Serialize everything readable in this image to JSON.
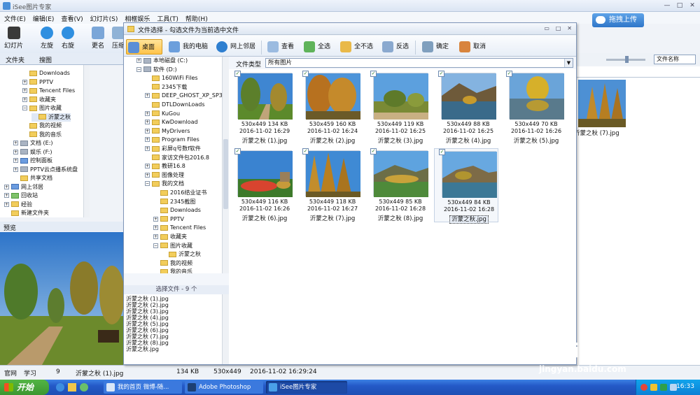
{
  "main_window": {
    "title": "iSee图片专家",
    "menu": [
      "文件(E)",
      "编辑(E)",
      "查看(V)",
      "幻灯片(S)",
      "相框娱乐",
      "工具(T)",
      "帮助(H)"
    ],
    "upload_button": "拖拽上传",
    "toolbar": [
      {
        "label": "幻灯片",
        "icon": "slideshow-icon"
      },
      {
        "label": "左旋",
        "icon": "rotate-left-icon"
      },
      {
        "label": "右旋",
        "icon": "rotate-right-icon"
      },
      {
        "label": "更名",
        "icon": "rename-icon"
      },
      {
        "label": "压缩",
        "icon": "compress-icon"
      }
    ],
    "tabs": [
      "文件夹",
      "搜图"
    ],
    "tree": [
      {
        "label": "Downloads",
        "indent": 2,
        "pm": "",
        "type": "folder"
      },
      {
        "label": "PPTV",
        "indent": 2,
        "pm": "+",
        "type": "folder"
      },
      {
        "label": "Tencent Files",
        "indent": 2,
        "pm": "+",
        "type": "folder"
      },
      {
        "label": "收藏夹",
        "indent": 2,
        "pm": "+",
        "type": "folder"
      },
      {
        "label": "图片收藏",
        "indent": 2,
        "pm": "−",
        "type": "folder"
      },
      {
        "label": "沂蒙之秋",
        "indent": 3,
        "pm": "",
        "type": "folder",
        "selected": true
      },
      {
        "label": "我的视频",
        "indent": 2,
        "pm": "",
        "type": "folder"
      },
      {
        "label": "我的音乐",
        "indent": 2,
        "pm": "",
        "type": "folder"
      },
      {
        "label": "文档 (E:)",
        "indent": 1,
        "pm": "+",
        "type": "drive"
      },
      {
        "label": "娱乐 (F:)",
        "indent": 1,
        "pm": "+",
        "type": "drive"
      },
      {
        "label": "控制面板",
        "indent": 1,
        "pm": "+",
        "type": "control"
      },
      {
        "label": "PPTV云点播系统盘",
        "indent": 1,
        "pm": "+",
        "type": "drive"
      },
      {
        "label": "共享文档",
        "indent": 1,
        "pm": "",
        "type": "folder"
      },
      {
        "label": "网上邻居",
        "indent": 0,
        "pm": "+",
        "type": "network"
      },
      {
        "label": "回收站",
        "indent": 0,
        "pm": "+",
        "type": "recycle"
      },
      {
        "label": "经验",
        "indent": 0,
        "pm": "+",
        "type": "folder"
      },
      {
        "label": "新建文件夹",
        "indent": 0,
        "pm": "",
        "type": "folder"
      }
    ],
    "preview_label": "预览",
    "sort_select": "文件名称",
    "right_thumb_name": "沂蒙之秋 (7).jpg"
  },
  "dialog": {
    "title": "文件选择 - 勾选文件为当前选中文件",
    "toolbar": [
      {
        "label": "桌面",
        "icon": "desktop-icon",
        "active": true
      },
      {
        "label": "我的电脑",
        "icon": "computer-icon"
      },
      {
        "label": "网上邻居",
        "icon": "network-icon"
      },
      {
        "label": "查看",
        "icon": "view-icon"
      },
      {
        "label": "全选",
        "icon": "select-all-icon"
      },
      {
        "label": "全不选",
        "icon": "select-none-icon"
      },
      {
        "label": "反选",
        "icon": "invert-select-icon"
      },
      {
        "label": "确定",
        "icon": "ok-icon"
      },
      {
        "label": "取消",
        "icon": "cancel-icon"
      }
    ],
    "file_type_label": "文件类型",
    "file_type_value": "所有图片",
    "tree": [
      {
        "label": "本地磁盘 (C:)",
        "indent": 1,
        "pm": "+",
        "type": "drive"
      },
      {
        "label": "软件 (D:)",
        "indent": 1,
        "pm": "−",
        "type": "drive"
      },
      {
        "label": "160WiFi Files",
        "indent": 2,
        "pm": "",
        "type": "folder"
      },
      {
        "label": "2345下载",
        "indent": 2,
        "pm": "",
        "type": "folder"
      },
      {
        "label": "DEEP_GHOST_XP_SP3_",
        "indent": 2,
        "pm": "+",
        "type": "folder"
      },
      {
        "label": "DTLDownLoads",
        "indent": 2,
        "pm": "",
        "type": "folder"
      },
      {
        "label": "KuGou",
        "indent": 2,
        "pm": "+",
        "type": "folder"
      },
      {
        "label": "KwDownload",
        "indent": 2,
        "pm": "+",
        "type": "folder"
      },
      {
        "label": "MyDrivers",
        "indent": 2,
        "pm": "+",
        "type": "folder"
      },
      {
        "label": "Program Files",
        "indent": 2,
        "pm": "+",
        "type": "folder"
      },
      {
        "label": "彩屏q号数f软件",
        "indent": 2,
        "pm": "+",
        "type": "folder"
      },
      {
        "label": "家访文件包2016.8",
        "indent": 2,
        "pm": "",
        "type": "folder"
      },
      {
        "label": "教研16.8",
        "indent": 2,
        "pm": "+",
        "type": "folder"
      },
      {
        "label": "图像处理",
        "indent": 2,
        "pm": "+",
        "type": "folder"
      },
      {
        "label": "我的文档",
        "indent": 2,
        "pm": "−",
        "type": "folder"
      },
      {
        "label": "2016结业证书",
        "indent": 3,
        "pm": "",
        "type": "folder"
      },
      {
        "label": "2345截图",
        "indent": 3,
        "pm": "",
        "type": "folder"
      },
      {
        "label": "Downloads",
        "indent": 3,
        "pm": "",
        "type": "folder"
      },
      {
        "label": "PPTV",
        "indent": 3,
        "pm": "+",
        "type": "folder"
      },
      {
        "label": "Tencent Files",
        "indent": 3,
        "pm": "+",
        "type": "folder"
      },
      {
        "label": "收藏夹",
        "indent": 3,
        "pm": "+",
        "type": "folder"
      },
      {
        "label": "图片收藏",
        "indent": 3,
        "pm": "−",
        "type": "folder"
      },
      {
        "label": "沂蒙之秋",
        "indent": 4,
        "pm": "",
        "type": "folder"
      },
      {
        "label": "我的视频",
        "indent": 3,
        "pm": "",
        "type": "folder"
      },
      {
        "label": "我的音乐",
        "indent": 3,
        "pm": "",
        "type": "folder"
      }
    ],
    "selection_header": "选择文件 - 9 个",
    "selection_list": [
      "沂蒙之秋 (1).jpg",
      "沂蒙之秋 (2).jpg",
      "沂蒙之秋 (3).jpg",
      "沂蒙之秋 (4).jpg",
      "沂蒙之秋 (5).jpg",
      "沂蒙之秋 (6).jpg",
      "沂蒙之秋 (7).jpg",
      "沂蒙之秋 (8).jpg",
      "沂蒙之秋.jpg"
    ],
    "thumbnails": [
      {
        "name": "沂蒙之秋 (1).jpg",
        "dims": "530x449",
        "size": "134 KB",
        "date": "2016-11-02 16:29",
        "checked": true
      },
      {
        "name": "沂蒙之秋 (2).jpg",
        "dims": "530x459",
        "size": "160 KB",
        "date": "2016-11-02 16:24",
        "checked": true
      },
      {
        "name": "沂蒙之秋 (3).jpg",
        "dims": "530x449",
        "size": "119 KB",
        "date": "2016-11-02 16:25",
        "checked": true
      },
      {
        "name": "沂蒙之秋 (4).jpg",
        "dims": "530x449",
        "size": "88 KB",
        "date": "2016-11-02 16:25",
        "checked": true
      },
      {
        "name": "沂蒙之秋 (5).jpg",
        "dims": "530x449",
        "size": "70 KB",
        "date": "2016-11-02 16:26",
        "checked": true
      },
      {
        "name": "沂蒙之秋 (6).jpg",
        "dims": "530x449",
        "size": "116 KB",
        "date": "2016-11-02 16:26",
        "checked": true
      },
      {
        "name": "沂蒙之秋 (7).jpg",
        "dims": "530x449",
        "size": "118 KB",
        "date": "2016-11-02 16:27",
        "checked": true
      },
      {
        "name": "沂蒙之秋 (8).jpg",
        "dims": "530x449",
        "size": "85 KB",
        "date": "2016-11-02 16:28",
        "checked": true
      },
      {
        "name": "沂蒙之秋.jpg",
        "dims": "530x449",
        "size": "84 KB",
        "date": "2016-11-02 16:28",
        "checked": true,
        "selected": true
      }
    ]
  },
  "status_bar": {
    "site": "官网",
    "learn": "学习",
    "count": "9",
    "filename": "沂蒙之秋 (1).jpg",
    "size": "134 KB",
    "dims": "530x449",
    "date": "2016-11-02 16:29:24"
  },
  "taskbar": {
    "start": "开始",
    "tasks": [
      {
        "label": "我的首页 微博-随...",
        "icon": "browser-icon"
      },
      {
        "label": "Adobe Photoshop",
        "icon": "photoshop-icon"
      },
      {
        "label": "iSee图片专家",
        "icon": "isee-icon",
        "active": true
      }
    ],
    "clock": "16:33"
  },
  "watermark": {
    "text": "jingyan.baidu.com"
  }
}
